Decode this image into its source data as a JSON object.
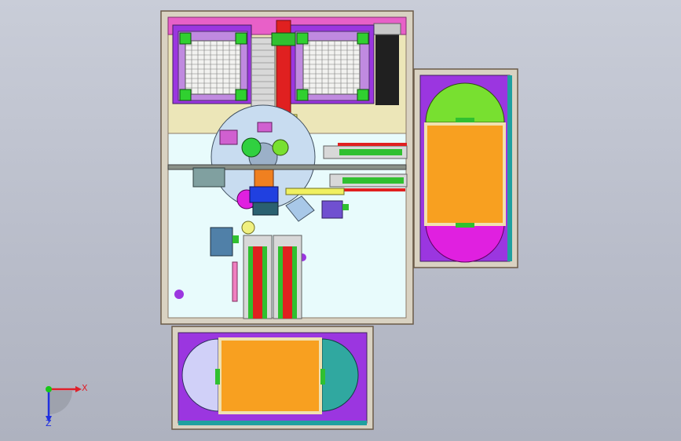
{
  "viewport": {
    "background_top": "#c9cdd8",
    "background_bottom": "#aeb2bf"
  },
  "triad": {
    "x_label": "X",
    "z_label": "Z",
    "x_color": "#e0202a",
    "y_color": "#18c818",
    "z_color": "#2030e0"
  },
  "palette": {
    "frame": "#d9d2c2",
    "frame_edge": "#6a5a48",
    "floor": "#e8fbfc",
    "purple": "#9b36e0",
    "violet": "#c08ae0",
    "pink": "#f080c0",
    "magenta": "#e020e0",
    "lime": "#78e030",
    "green": "#30c030",
    "orange": "#f8a020",
    "teal": "#20a0a0",
    "red": "#e02020",
    "yellow": "#f0f080",
    "lightblue": "#c8dcf0",
    "steel": "#5080a8"
  }
}
